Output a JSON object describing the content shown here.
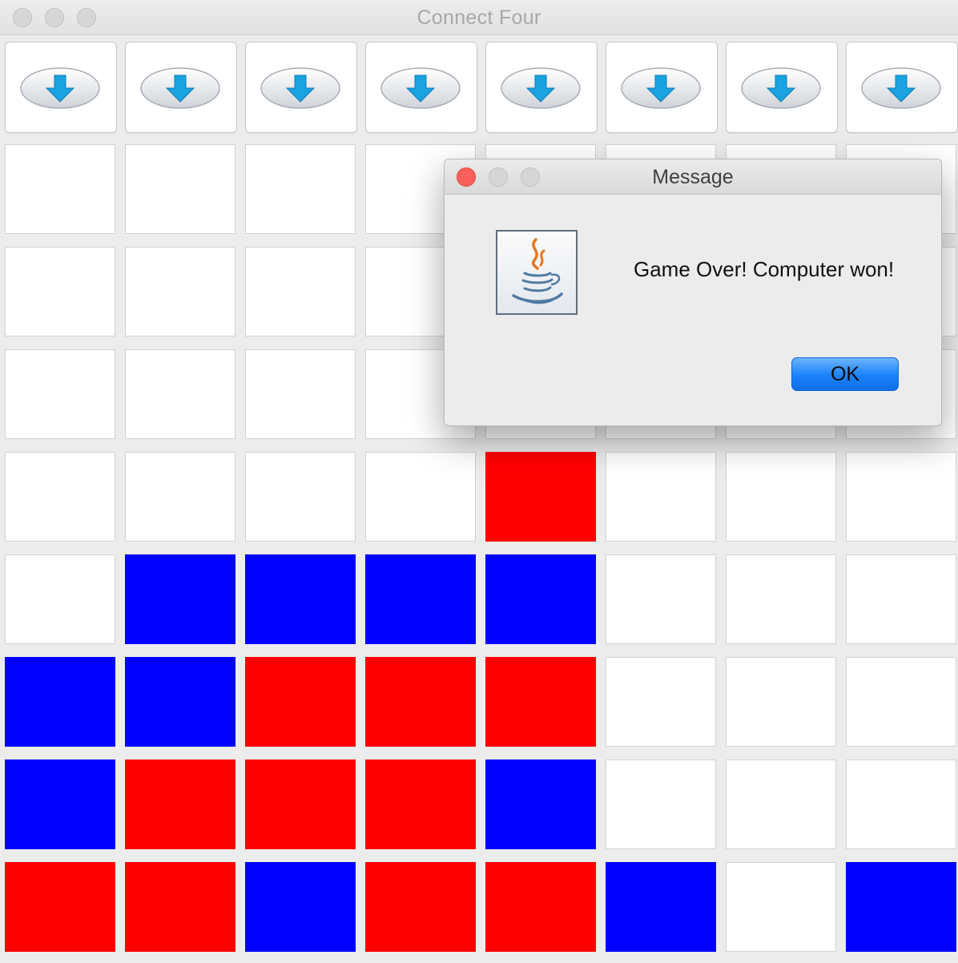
{
  "window": {
    "title": "Connect Four"
  },
  "drop_buttons": {
    "icon": "down-arrow-icon",
    "count": 8,
    "color": "#1ba2e0"
  },
  "board": {
    "columns": 8,
    "colors": {
      "red": "#ff0000",
      "blue": "#0000ff",
      "empty": "#ffffff"
    },
    "rows": [
      [
        "empty",
        "empty",
        "empty",
        "empty",
        "empty",
        "empty",
        "empty",
        "empty"
      ],
      [
        "empty",
        "empty",
        "empty",
        "empty",
        "empty",
        "empty",
        "empty",
        "empty"
      ],
      [
        "empty",
        "empty",
        "empty",
        "empty",
        "empty",
        "empty",
        "empty",
        "empty"
      ],
      [
        "empty",
        "empty",
        "empty",
        "empty",
        "red",
        "empty",
        "empty",
        "empty"
      ],
      [
        "empty",
        "blue",
        "blue",
        "blue",
        "blue",
        "empty",
        "empty",
        "empty"
      ],
      [
        "blue",
        "blue",
        "red",
        "red",
        "red",
        "empty",
        "empty",
        "empty"
      ],
      [
        "blue",
        "red",
        "red",
        "red",
        "blue",
        "empty",
        "empty",
        "empty"
      ],
      [
        "red",
        "red",
        "blue",
        "red",
        "red",
        "blue",
        "empty",
        "blue"
      ]
    ]
  },
  "dialog": {
    "title": "Message",
    "message": "Game Over! Computer won!",
    "ok_label": "OK",
    "icon": "java-icon"
  }
}
